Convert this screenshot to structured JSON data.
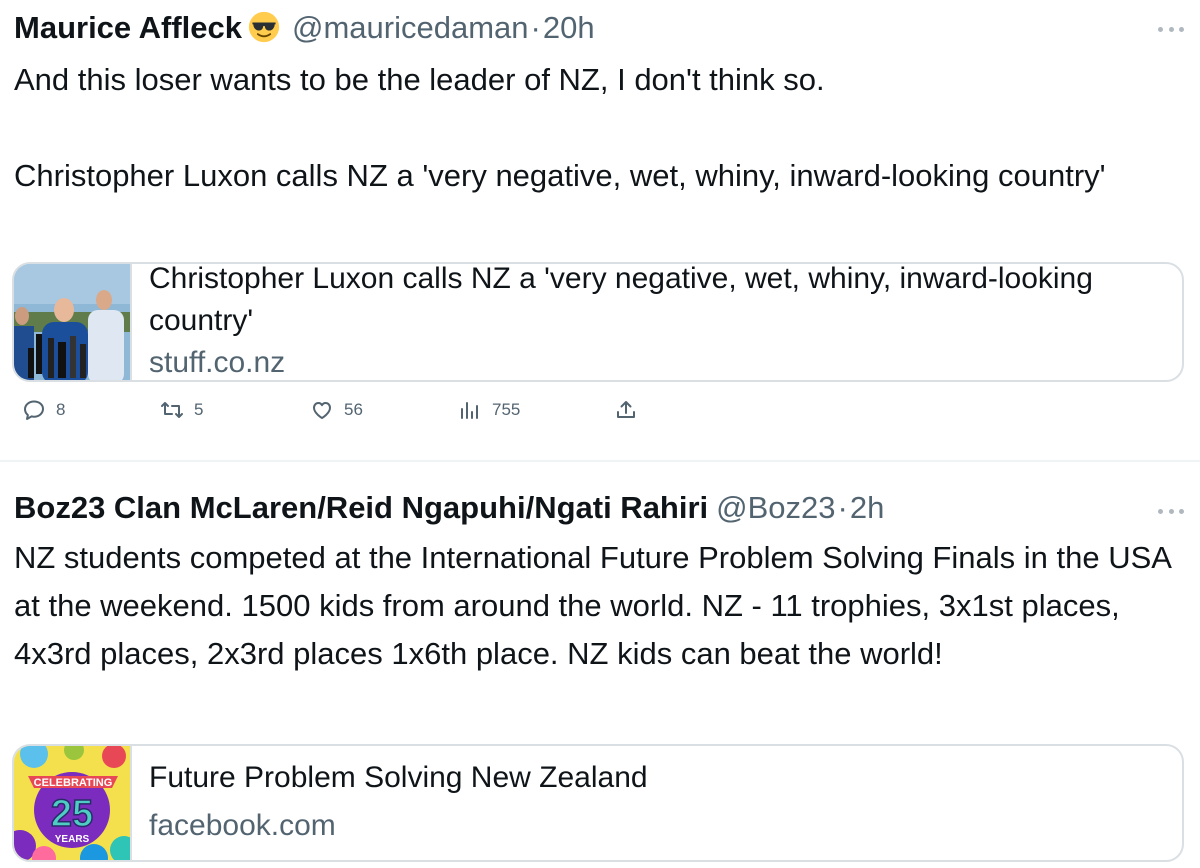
{
  "tweets": [
    {
      "author_name": "Maurice Affleck",
      "author_emoji": "sunglasses-emoji",
      "handle": "@mauricedaman",
      "separator": "·",
      "time": "20h",
      "text_line1": "And this loser wants to be the leader of NZ, I don't think so.",
      "text_line2": "Christopher Luxon calls NZ a 'very negative, wet, whiny, inward-looking country'",
      "card": {
        "title": "Christopher Luxon calls NZ a 'very negative, wet, whiny, inward-looking country'",
        "domain": "stuff.co.nz"
      },
      "actions": {
        "replies": "8",
        "retweets": "5",
        "likes": "56",
        "views": "755"
      }
    },
    {
      "author_name": "Boz23 Clan McLaren/Reid Ngapuhi/Ngati Rahiri",
      "handle": "@Boz23",
      "separator": "·",
      "time": "2h",
      "text": "NZ students competed at the International Future Problem Solving Finals in the USA at the weekend. 1500 kids from around the world. NZ - 11 trophies, 3x1st places, 4x3rd places, 2x3rd places 1x6th place. NZ kids can beat the world!",
      "card": {
        "title": "Future Problem Solving New Zealand",
        "domain": "facebook.com",
        "thumb_text_celebrating": "CELEBRATING",
        "thumb_text_number": "25",
        "thumb_text_years": "YEARS"
      }
    }
  ],
  "colors": {
    "text_primary": "#0f1419",
    "text_secondary": "#536471",
    "border": "#d9dfe3"
  },
  "icons": [
    "reply-icon",
    "retweet-icon",
    "like-icon",
    "views-icon",
    "share-icon",
    "more-icon"
  ]
}
